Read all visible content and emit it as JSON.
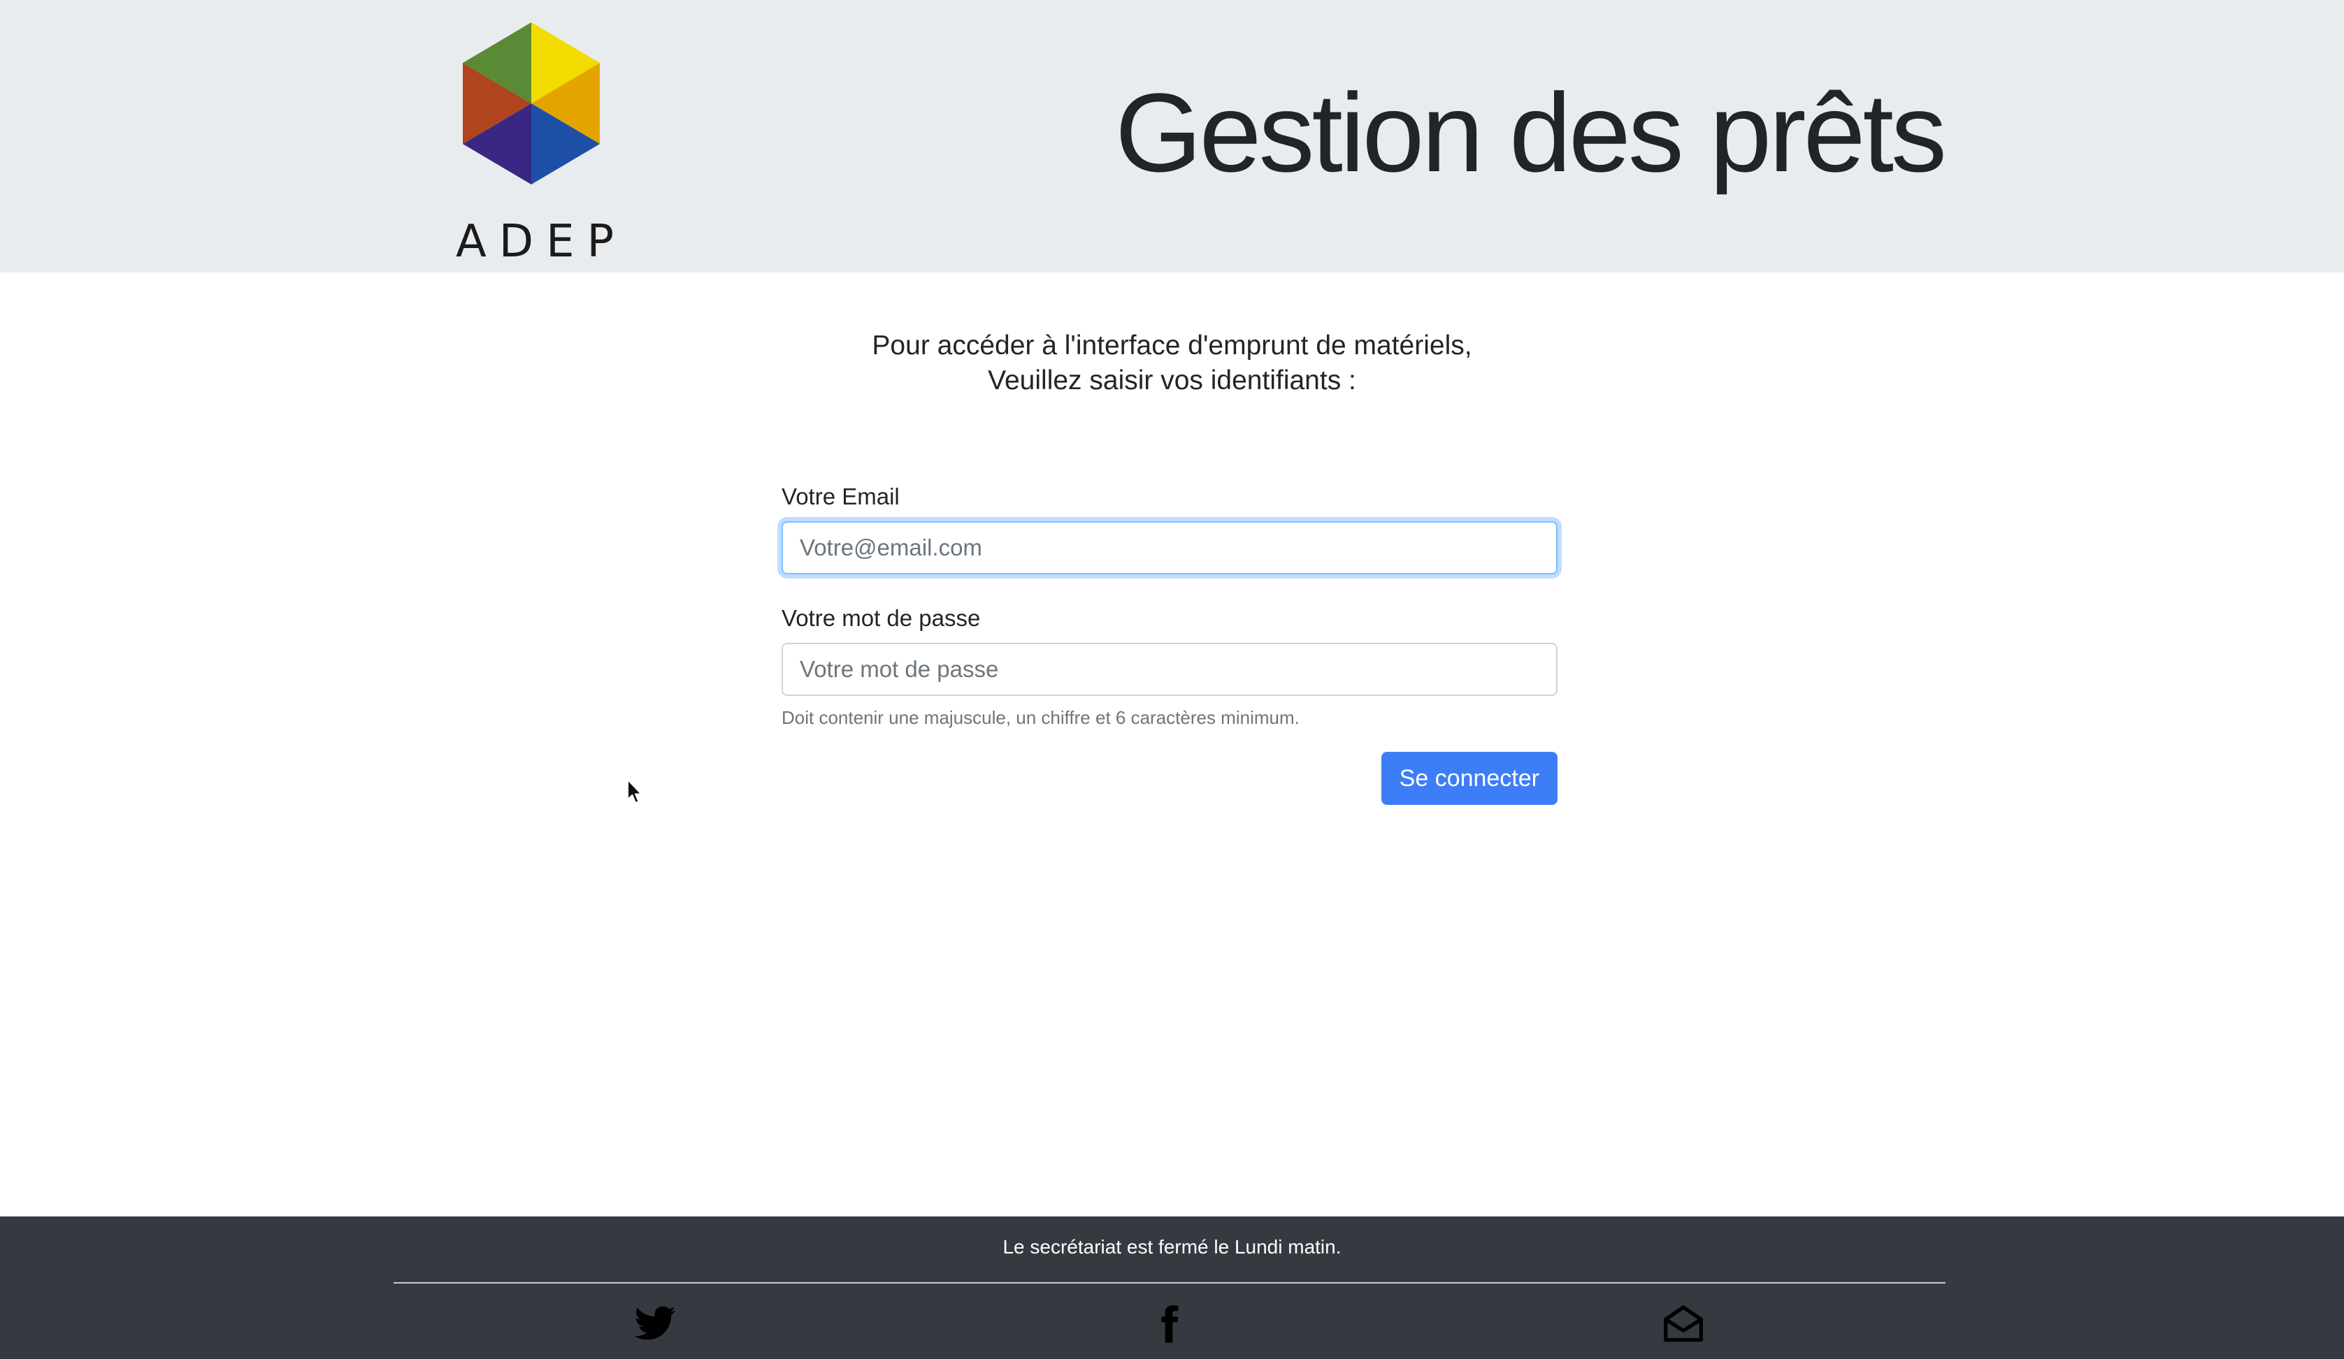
{
  "header": {
    "logo_text": "ADEP",
    "title": "Gestion des prêts"
  },
  "intro": {
    "line1": "Pour accéder à l'interface d'emprunt de matériels,",
    "line2": "Veuillez saisir vos identifiants :"
  },
  "login_form": {
    "email_label": "Votre Email",
    "email_placeholder": "Votre@email.com",
    "email_value": "",
    "password_label": "Votre mot de passe",
    "password_placeholder": "Votre mot de passe",
    "password_value": "",
    "password_help": "Doit contenir une majuscule, un chiffre et 6 caractères minimum.",
    "submit_label": "Se connecter"
  },
  "footer": {
    "notice": "Le secrétariat est fermé le Lundi matin.",
    "social_icons": [
      "twitter-icon",
      "facebook-icon",
      "mail-icon"
    ]
  },
  "colors": {
    "header_bg": "#e9ecef",
    "footer_bg": "#343a40",
    "button_bg": "#3d7ef7",
    "input_focus": "#80bdff",
    "logo_segments": [
      "#f2dc00",
      "#e3a400",
      "#1e4fa6",
      "#3a2784",
      "#b0441e",
      "#5a8a35"
    ]
  }
}
